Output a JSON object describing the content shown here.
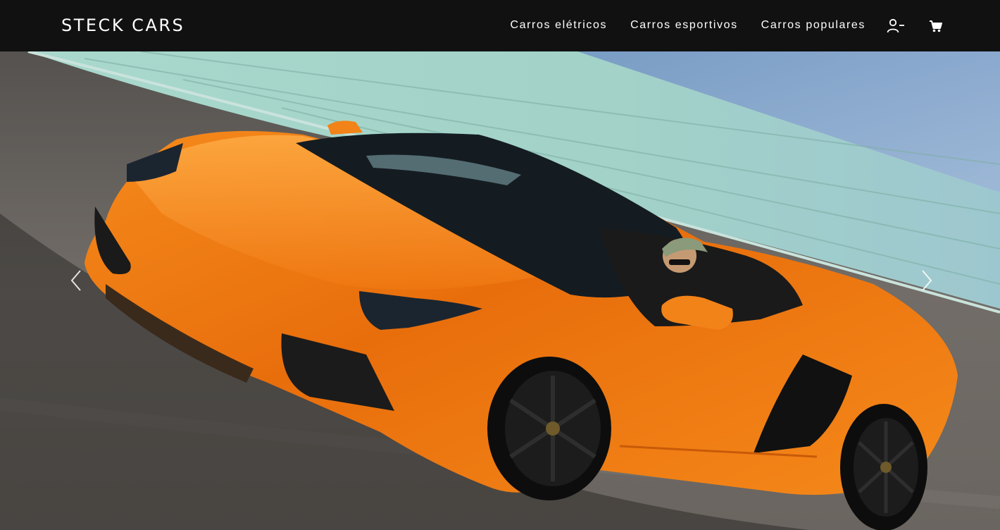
{
  "header": {
    "brand": "STECK CARS",
    "nav": [
      {
        "label": "Carros elétricos"
      },
      {
        "label": "Carros esportivos"
      },
      {
        "label": "Carros populares"
      }
    ],
    "icons": {
      "user": "user-minus-icon",
      "cart": "cart-icon"
    }
  },
  "carousel": {
    "slide_image": "orange-convertible-sports-car",
    "controls": {
      "prev": "chevron-left-icon",
      "next": "chevron-right-icon"
    }
  },
  "colors": {
    "navbar_bg": "#111111",
    "nav_text": "#ffffff",
    "car_body": "#f07a12",
    "wall": "#9fd0c4",
    "road": "#6b6762"
  }
}
